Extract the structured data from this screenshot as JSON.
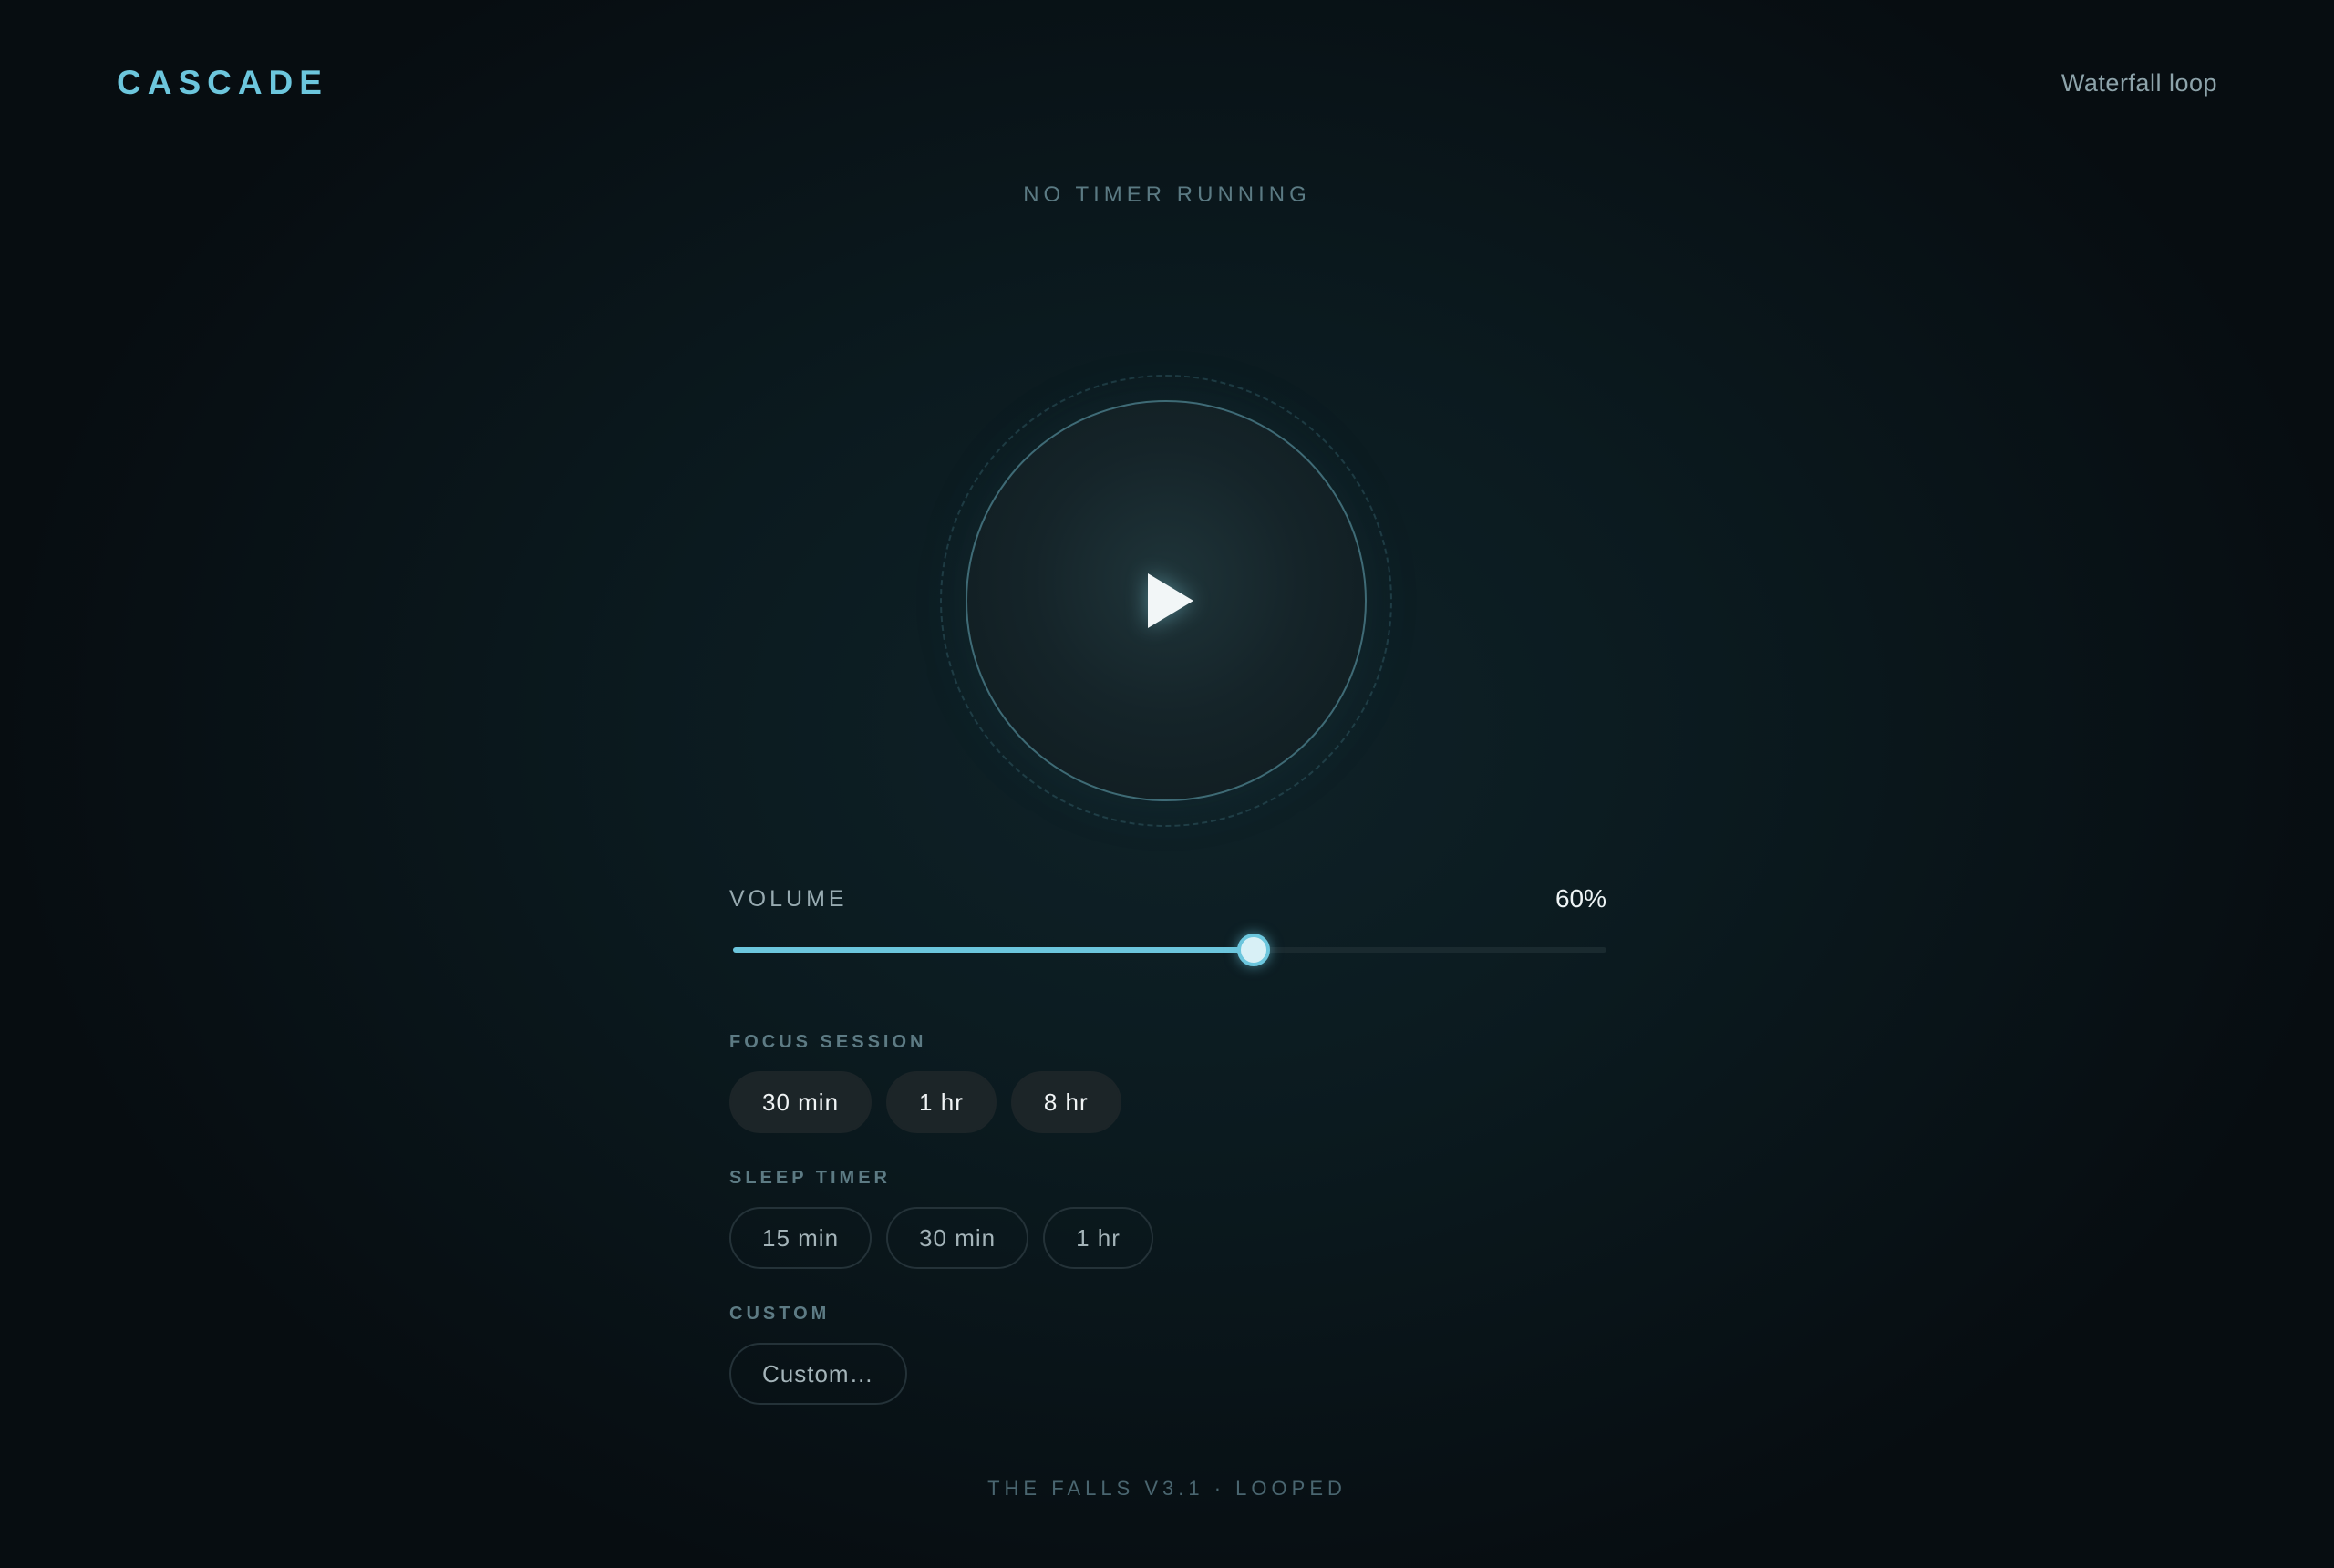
{
  "header": {
    "brand": "CASCADE",
    "track": "Waterfall loop"
  },
  "status": {
    "timer": "NO TIMER RUNNING"
  },
  "player": {
    "play_icon": "play-icon",
    "state": "paused"
  },
  "volume": {
    "label": "VOLUME",
    "value_text": "60%",
    "value": 0.6,
    "accent_color": "#6cc6dd"
  },
  "focus_session": {
    "title": "FOCUS SESSION",
    "options": [
      "30 min",
      "1 hr",
      "8 hr"
    ]
  },
  "sleep_timer": {
    "title": "SLEEP TIMER",
    "options": [
      "15 min",
      "30 min",
      "1 hr"
    ]
  },
  "custom": {
    "title": "CUSTOM",
    "button": "Custom…"
  },
  "footer": {
    "text": "THE FALLS V3.1 · LOOPED"
  }
}
